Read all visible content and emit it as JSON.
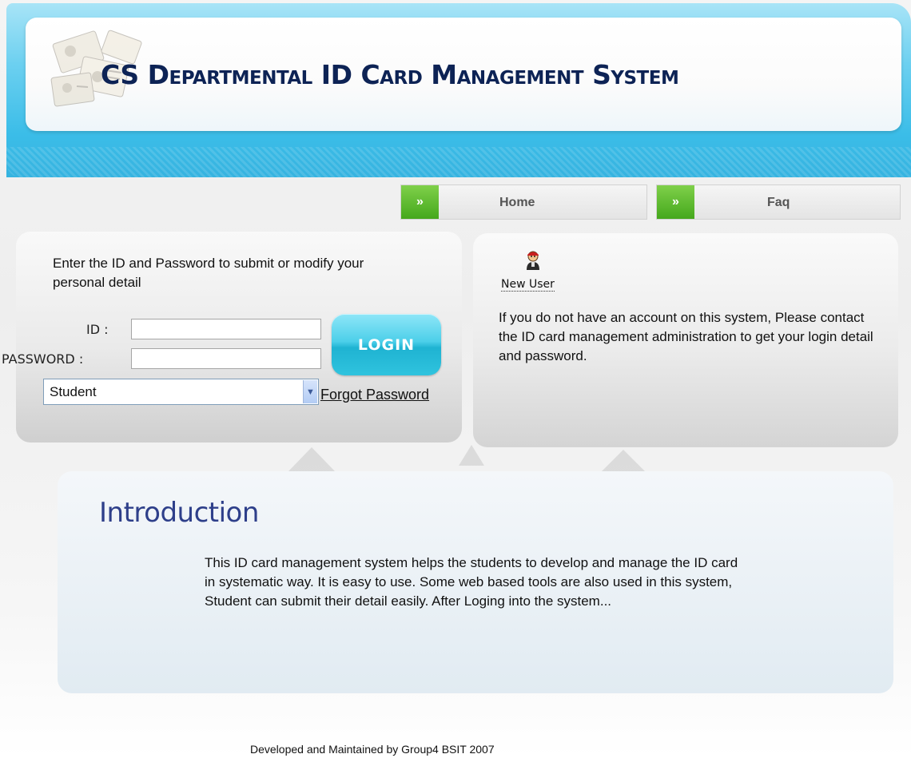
{
  "header": {
    "title": "CS Departmental ID Card Management System"
  },
  "nav": {
    "items": [
      {
        "label": "Home",
        "arrow": "»"
      },
      {
        "label": "Faq",
        "arrow": "»"
      }
    ]
  },
  "login": {
    "instructions": "Enter the ID and Password to submit or modify your personal detail",
    "id_label": "ID :",
    "id_value": "",
    "password_label": "PASSWORD :",
    "password_value": "",
    "button_label": "LOGIN",
    "role_selected": "Student",
    "forgot_password": "Forgot Password"
  },
  "new_user": {
    "label": "New User",
    "icon": "new-user-person-icon",
    "text": "If you do not have an account on this system, Please contact the ID card management administration to get your login detail and password."
  },
  "introduction": {
    "title": "Introduction",
    "text": "This ID card management system helps the students to develop and manage the ID card in systematic way. It is easy to use. Some web based tools are also used in this system, Student can submit their detail easily. After Loging into the system..."
  },
  "footer": {
    "text": "Developed and Maintained by Group4 BSIT 2007"
  },
  "colors": {
    "header_blue": "#3bbde8",
    "nav_arrow_green": "#45a81c",
    "login_button": "#2fc3de",
    "title_navy": "#0d2355",
    "intro_title": "#2e3f8a"
  }
}
